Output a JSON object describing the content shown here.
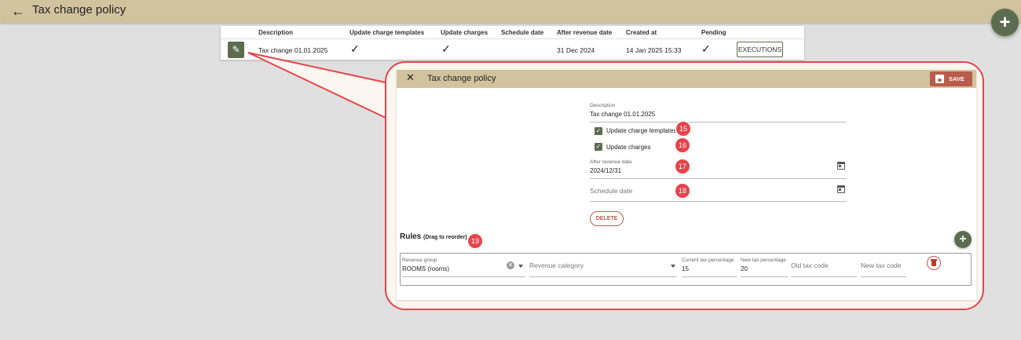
{
  "header": {
    "back_icon": "arrow-left-icon",
    "title": "Tax change policy",
    "add_icon": "plus-icon",
    "add_label": "+"
  },
  "table": {
    "columns": [
      "Description",
      "Update charge templates",
      "Update charges",
      "Schedule date",
      "After revenue date",
      "Created at",
      "Pending"
    ],
    "rows": [
      {
        "description": "Tax change 01.01.2025",
        "update_charge_templates": "✓",
        "update_charges": "✓",
        "schedule_date": "",
        "after_revenue_date": "31 Dec 2024",
        "created_at": "14 Jan 2025 15:33",
        "pending": "✓",
        "edit_icon": "pencil-icon",
        "edit_glyph": "✎",
        "executions_label": "EXECUTIONS"
      }
    ]
  },
  "dialog": {
    "close_glyph": "✕",
    "title": "Tax change policy",
    "save_label": "SAVE",
    "description_label": "Description",
    "description_value": "Tax change 01.01.2025",
    "update_charge_templates_label": "Update charge templates",
    "update_charge_templates_checked": true,
    "update_charges_label": "Update charges",
    "update_charges_checked": true,
    "check_glyph": "✓",
    "after_revenue_date_label": "After revenue date",
    "after_revenue_date_value": "2024/12/31",
    "schedule_date_placeholder": "Schedule date",
    "delete_label": "DELETE",
    "rules": {
      "title": "Rules",
      "subtitle": "(Drag to reorder)",
      "add_label": "+",
      "items": [
        {
          "revenue_group_label": "Revenue group",
          "revenue_group_value": "ROOMS (rooms)",
          "clear_glyph": "✕",
          "revenue_category_placeholder": "Revenue category",
          "current_tax_label": "Current tax percentage",
          "current_tax_value": "15",
          "new_tax_label": "New tax percentage",
          "new_tax_value": "20",
          "old_tax_code_placeholder": "Old tax code",
          "new_tax_code_placeholder": "New tax code"
        }
      ]
    }
  },
  "badges": [
    "15",
    "16",
    "17",
    "18",
    "19"
  ],
  "colors": {
    "header_bg": "#d2c39f",
    "accent_green": "#5c6c50",
    "save_red": "#b85c4c",
    "callout_red": "#e5444b",
    "page_bg": "#e0e0e0"
  }
}
